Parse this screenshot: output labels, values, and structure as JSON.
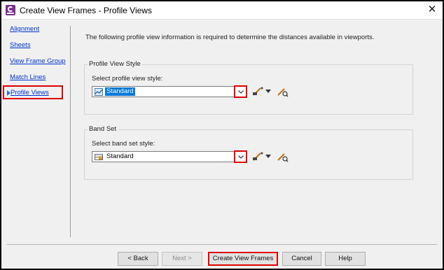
{
  "window": {
    "title": "Create View Frames - Profile Views",
    "close_glyph": "✕"
  },
  "sidebar": {
    "items": [
      {
        "label": "Alignment",
        "active": false
      },
      {
        "label": "Sheets",
        "active": false
      },
      {
        "label": "View Frame Group",
        "active": false
      },
      {
        "label": "Match Lines",
        "active": false
      },
      {
        "label": "Profile Views",
        "active": true
      }
    ]
  },
  "main": {
    "intro": "The following profile view information is required to determine the distances available in viewports.",
    "profile_view_style": {
      "group_title": "Profile View Style",
      "field_label": "Select profile view style:",
      "value": "Standard",
      "icon": "profile-view-style-icon"
    },
    "band_set": {
      "group_title": "Band Set",
      "field_label": "Select band set style:",
      "value": "Standard",
      "icon": "band-set-icon"
    }
  },
  "footer": {
    "back_label": "< Back",
    "next_label": "Next >",
    "create_label": "Create View Frames",
    "cancel_label": "Cancel",
    "help_label": "Help"
  },
  "colors": {
    "highlight_red": "#e00000",
    "link_blue": "#0033cc",
    "selection_blue": "#0078d7",
    "app_icon_purple": "#7b2d8e"
  }
}
